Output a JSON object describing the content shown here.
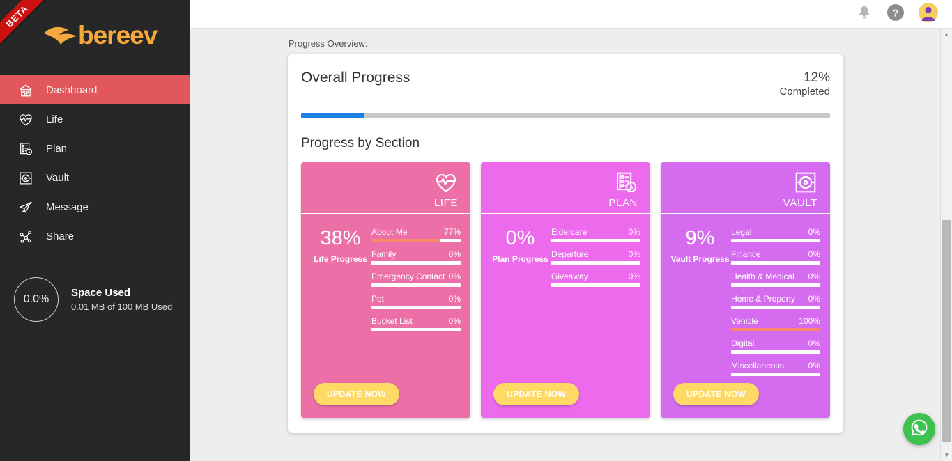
{
  "brand": {
    "name": "bereev",
    "badge": "BETA"
  },
  "sidebar": {
    "items": [
      {
        "label": "Dashboard",
        "icon": "home-icon",
        "active": true
      },
      {
        "label": "Life",
        "icon": "heartbeat-icon",
        "active": false
      },
      {
        "label": "Plan",
        "icon": "checklist-clock-icon",
        "active": false
      },
      {
        "label": "Vault",
        "icon": "vault-icon",
        "active": false
      },
      {
        "label": "Message",
        "icon": "paper-plane-icon",
        "active": false
      },
      {
        "label": "Share",
        "icon": "share-nodes-icon",
        "active": false
      }
    ],
    "space": {
      "percent": "0.0%",
      "title": "Space Used",
      "detail": "0.01 MB of 100 MB Used"
    }
  },
  "topbar": {
    "icons": [
      "notification-bell-icon",
      "help-question-icon",
      "user-avatar"
    ]
  },
  "content": {
    "overview_label": "Progress Overview:",
    "overall": {
      "title": "Overall Progress",
      "percent": "12%",
      "status": "Completed",
      "fill_percent": 12
    },
    "section_heading": "Progress by Section",
    "cards": [
      {
        "name": "LIFE",
        "icon": "heartbeat-icon",
        "color": "#ED6FA8",
        "big_percent": "38%",
        "progress_label": "Life Progress",
        "button": "UPDATE NOW",
        "rows": [
          {
            "label": "About Me",
            "value": "77%",
            "fill": 77
          },
          {
            "label": "Family",
            "value": "0%",
            "fill": 0
          },
          {
            "label": "Emergency Contact",
            "value": "0%",
            "fill": 0
          },
          {
            "label": "Pet",
            "value": "0%",
            "fill": 0
          },
          {
            "label": "Bucket List",
            "value": "0%",
            "fill": 0
          }
        ]
      },
      {
        "name": "PLAN",
        "icon": "checklist-clock-icon",
        "color": "#EC6AEB",
        "big_percent": "0%",
        "progress_label": "Plan Progress",
        "button": "UPDATE NOW",
        "rows": [
          {
            "label": "Eldercare",
            "value": "0%",
            "fill": 0
          },
          {
            "label": "Departure",
            "value": "0%",
            "fill": 0
          },
          {
            "label": "Giveaway",
            "value": "0%",
            "fill": 0
          }
        ]
      },
      {
        "name": "VAULT",
        "icon": "vault-icon",
        "color": "#D56CF0",
        "big_percent": "9%",
        "progress_label": "Vault Progress",
        "button": "UPDATE NOW",
        "rows": [
          {
            "label": "Legal",
            "value": "0%",
            "fill": 0
          },
          {
            "label": "Finance",
            "value": "0%",
            "fill": 0
          },
          {
            "label": "Health & Medical",
            "value": "0%",
            "fill": 0
          },
          {
            "label": "Home & Property",
            "value": "0%",
            "fill": 0
          },
          {
            "label": "Vehicle",
            "value": "100%",
            "fill": 100
          },
          {
            "label": "Digital",
            "value": "0%",
            "fill": 0
          },
          {
            "label": "Miscellaneous",
            "value": "0%",
            "fill": 0
          }
        ]
      }
    ]
  },
  "floating": {
    "whatsapp": "whatsapp-icon"
  },
  "colors": {
    "accent_blue": "#1a81e8",
    "sidebar_bg": "#272727",
    "active_nav": "#e2575c",
    "bar_fill": "#f9886a",
    "button": "#ffd966",
    "whatsapp": "#3dc14f"
  }
}
